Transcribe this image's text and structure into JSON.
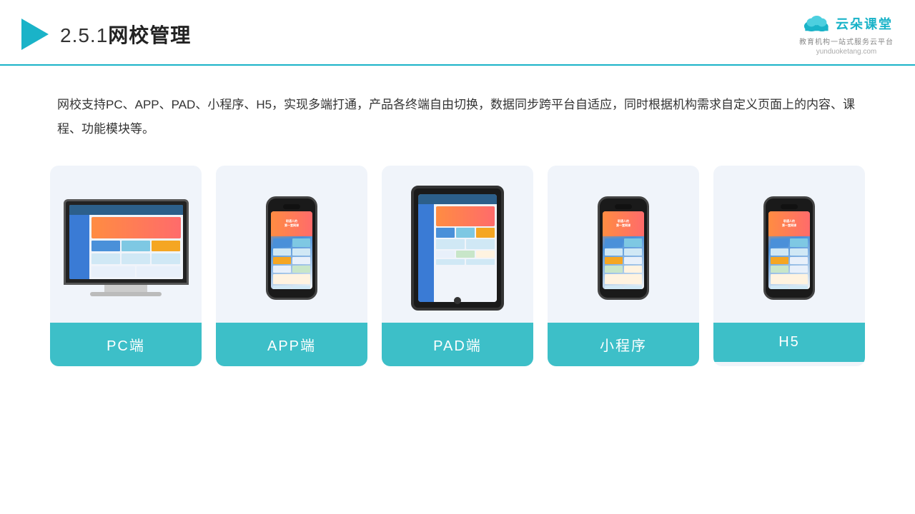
{
  "header": {
    "section_number": "2.5.1",
    "title": "网校管理",
    "logo_name": "云朵课堂",
    "logo_url": "yunduoketang.com",
    "logo_tagline": "教育机构一站式服务云平台"
  },
  "description": {
    "text": "网校支持PC、APP、PAD、小程序、H5，实现多端打通，产品各终端自由切换，数据同步跨平台自适应，同时根据机构需求自定义页面上的内容、课程、功能模块等。"
  },
  "cards": [
    {
      "id": "pc",
      "label": "PC端"
    },
    {
      "id": "app",
      "label": "APP端"
    },
    {
      "id": "pad",
      "label": "PAD端"
    },
    {
      "id": "miniapp",
      "label": "小程序"
    },
    {
      "id": "h5",
      "label": "H5"
    }
  ],
  "colors": {
    "accent": "#1ab3c8",
    "card_bg": "#f0f4fa",
    "card_label_bg": "#3dbfc8",
    "card_label_text": "#ffffff"
  }
}
